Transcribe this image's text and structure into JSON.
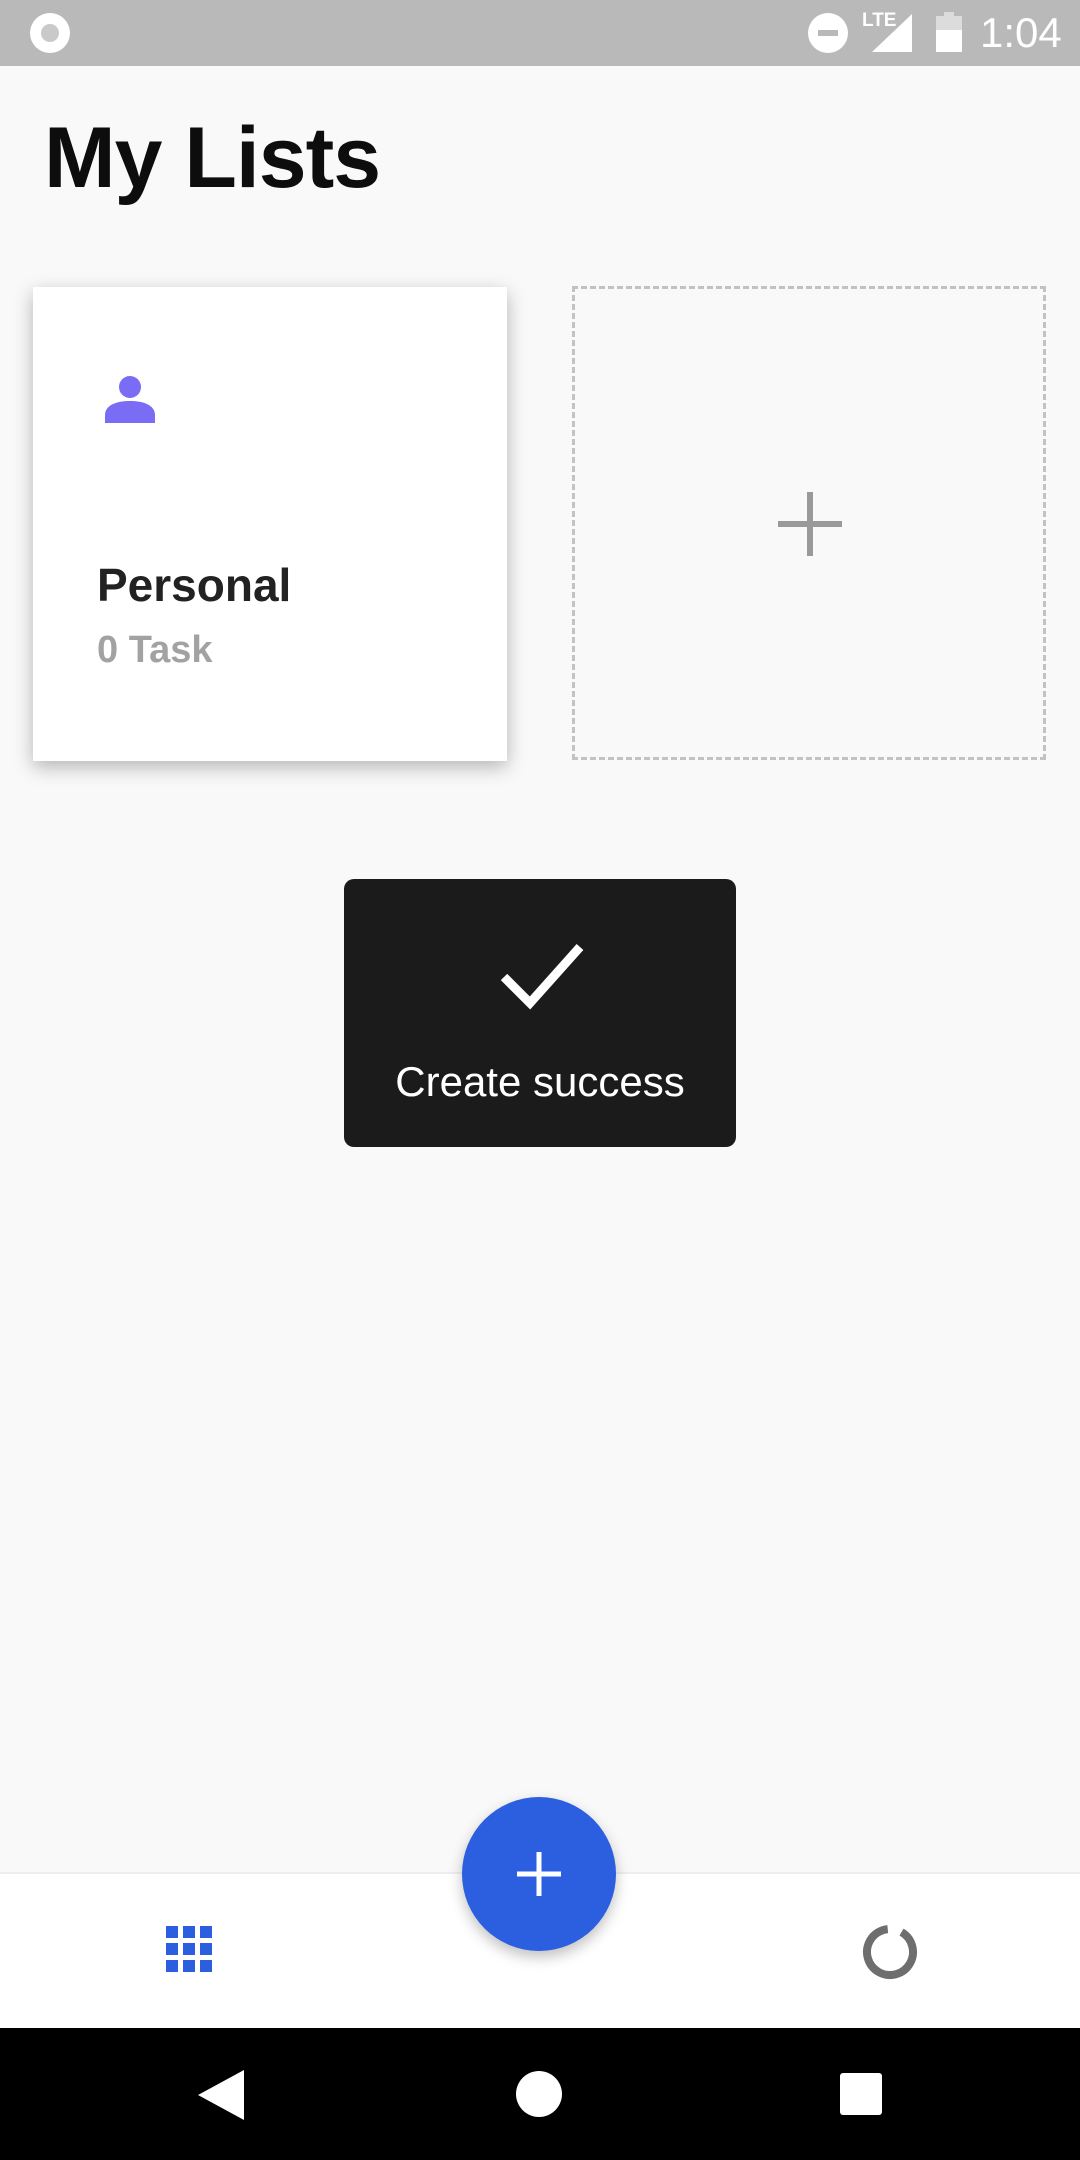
{
  "status_bar": {
    "time": "1:04",
    "network": "LTE",
    "icons": [
      "screen-record-icon",
      "do-not-disturb-icon",
      "signal-icon",
      "battery-icon"
    ]
  },
  "header": {
    "title": "My Lists"
  },
  "lists": [
    {
      "icon": "person-icon",
      "name": "Personal",
      "count": "0 Task",
      "icon_color": "#7B6CF6"
    }
  ],
  "add_list": {
    "icon": "plus-icon"
  },
  "toast": {
    "icon": "check-icon",
    "message": "Create success"
  },
  "tab_bar": {
    "left_icon": "grid-icon",
    "right_icon": "stats-ring-icon",
    "fab_icon": "plus-icon"
  },
  "nav_bar": {
    "icons": [
      "back-icon",
      "home-icon",
      "recents-icon"
    ]
  },
  "colors": {
    "accent": "#2B5FE0",
    "toast_bg": "#1B1B1B",
    "card_icon": "#7B6CF6",
    "muted_text": "#A2A2A2"
  }
}
